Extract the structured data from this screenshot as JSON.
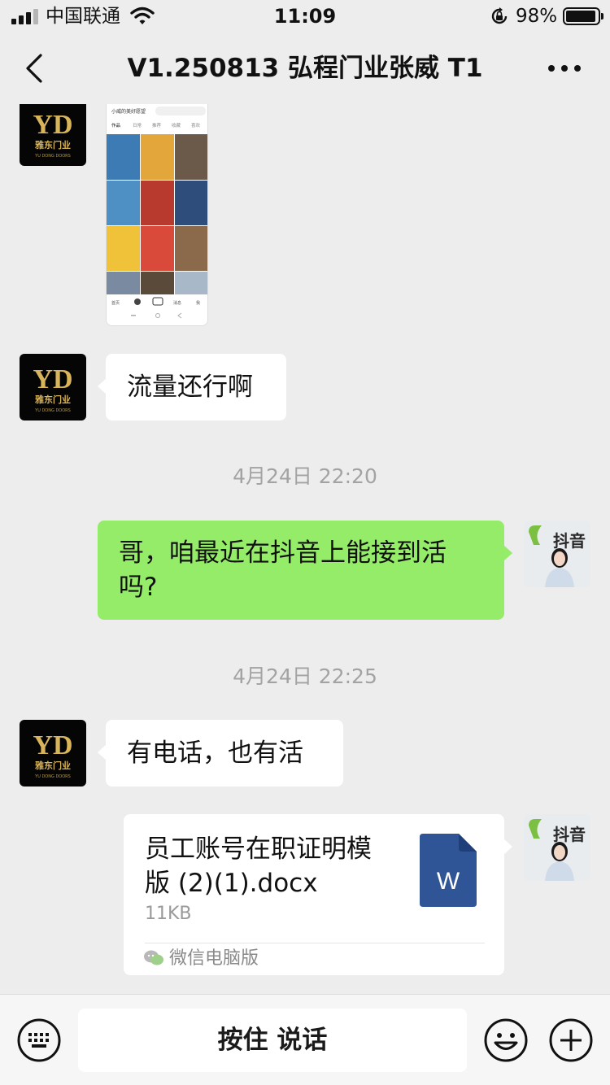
{
  "status_bar": {
    "carrier": "中国联通",
    "time": "11:09",
    "battery_percent": "98%",
    "icons": [
      "signal-icon",
      "wifi-icon",
      "orientation-lock-icon",
      "battery-icon"
    ]
  },
  "nav": {
    "title": "V1.250813 弘程门业张威 T1",
    "back_icon": "chevron-left-icon",
    "more_icon": "more-icon"
  },
  "avatars": {
    "brand_logo": "YD",
    "brand_name": "雅东门业",
    "brand_sub": "YU DONG DOORS",
    "self_logo": "抖音"
  },
  "messages": [
    {
      "type": "image",
      "side": "left",
      "image_caption": "小威的美好愿望",
      "image_tabs": [
        "作品",
        "日常",
        "推荐",
        "收藏",
        "喜欢"
      ],
      "image_nav": [
        "首页",
        "消息",
        "我"
      ]
    },
    {
      "type": "text",
      "side": "left",
      "text": "流量还行啊"
    },
    {
      "type": "time",
      "text": "4月24日 22:20"
    },
    {
      "type": "text",
      "side": "right",
      "text": "哥，咱最近在抖音上能接到活吗?"
    },
    {
      "type": "time",
      "text": "4月24日 22:25"
    },
    {
      "type": "text",
      "side": "left",
      "text": "有电话，也有活"
    },
    {
      "type": "file",
      "side": "right",
      "name": "员工账号在职证明模版 (2)(1).docx",
      "size": "11KB",
      "source": "微信电脑版",
      "icon_letter": "W"
    }
  ],
  "input_bar": {
    "hold_to_talk": "按住 说话",
    "icons": [
      "keyboard-icon",
      "emoji-icon",
      "plus-icon"
    ]
  },
  "colors": {
    "background": "#ededed",
    "bubble_self": "#95ec69",
    "bubble_other": "#ffffff",
    "word_icon": "#2f5597"
  }
}
